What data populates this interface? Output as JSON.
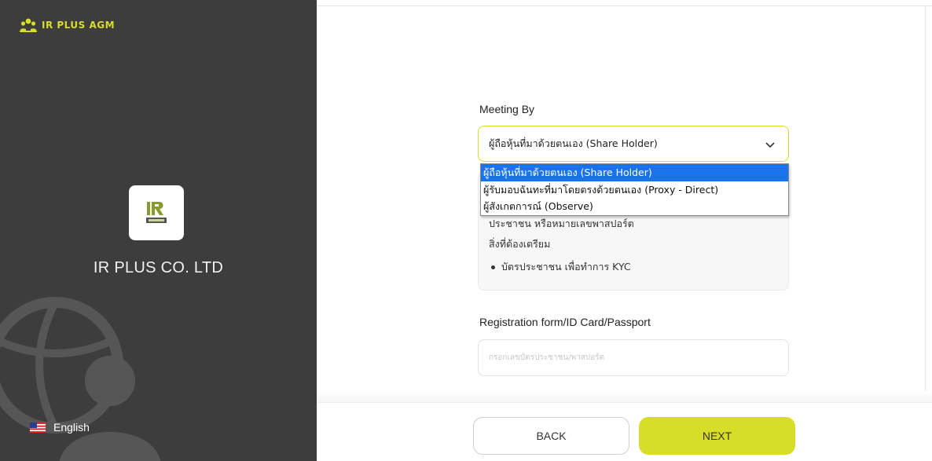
{
  "brand": {
    "name": "IR PLUS AGM",
    "icon": "meeting-people-icon",
    "accent_color": "#d8dd2a"
  },
  "company": {
    "name": "IR PLUS CO. LTD",
    "logo": "ir-plus-logo"
  },
  "language": {
    "label": "English",
    "flag_icon": "us-flag-icon"
  },
  "form": {
    "meeting_by": {
      "label": "Meeting By",
      "selected": "ผู้ถือหุ้นที่มาด้วยตนเอง (Share Holder)",
      "options": [
        "ผู้ถือหุ้นที่มาด้วยตนเอง (Share Holder)",
        "ผู้รับมอบฉันทะที่มาโดยตรงด้วยตนเอง (Proxy - Direct)",
        "ผู้สังเกตการณ์ (Observe)"
      ]
    },
    "info": {
      "line1": "ประชาชน หรือหมายเลขพาสปอร์ต",
      "line2": "สิ่งที่ต้องเตรียม",
      "bullet": "บัตรประชาชน เพื่อทำการ KYC"
    },
    "registration": {
      "label": "Registration form/ID Card/Passport",
      "value": "",
      "placeholder": "กรอกเลขบัตรประชาชน/พาสปอร์ต"
    }
  },
  "buttons": {
    "back": "BACK",
    "next": "NEXT"
  }
}
